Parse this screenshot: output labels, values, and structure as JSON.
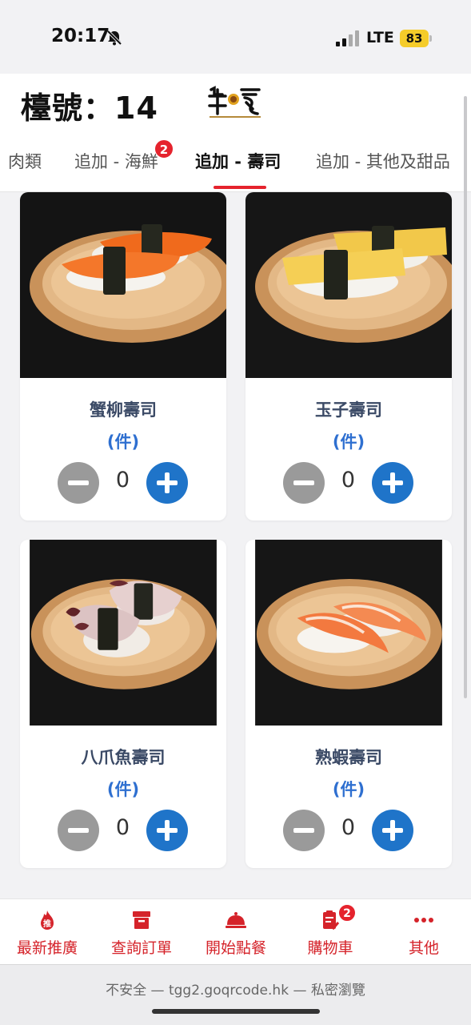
{
  "status_bar": {
    "time": "20:17",
    "network": "LTE",
    "battery": "83"
  },
  "header": {
    "table_number": "檯號：14"
  },
  "tabs": [
    {
      "label": "肉類"
    },
    {
      "label": "追加 - 海鮮",
      "badge": "2"
    },
    {
      "label": "追加 - 壽司",
      "active": true
    },
    {
      "label": "追加 - 其他及甜品"
    }
  ],
  "products": [
    {
      "name": "蟹柳壽司",
      "unit": "(件)",
      "quantity": "0"
    },
    {
      "name": "玉子壽司",
      "unit": "(件)",
      "quantity": "0"
    },
    {
      "name": "八爪魚壽司",
      "unit": "(件)",
      "quantity": "0"
    },
    {
      "name": "熟蝦壽司",
      "unit": "(件)",
      "quantity": "0"
    }
  ],
  "bottom_nav": [
    {
      "label": "最新推廣",
      "icon": "promo-fire-icon"
    },
    {
      "label": "查詢訂單",
      "icon": "order-box-icon"
    },
    {
      "label": "開始點餐",
      "icon": "cloche-icon"
    },
    {
      "label": "購物車",
      "icon": "cart-clipboard-icon",
      "badge": "2"
    },
    {
      "label": "其他",
      "icon": "more-dots-icon"
    }
  ],
  "url_bar": {
    "text": "不安全 — tgg2.goqrcode.hk — 私密瀏覽"
  },
  "colors": {
    "accent_red": "#e5232d",
    "primary_blue": "#1f74c9",
    "minus_gray": "#9a9a9a"
  }
}
